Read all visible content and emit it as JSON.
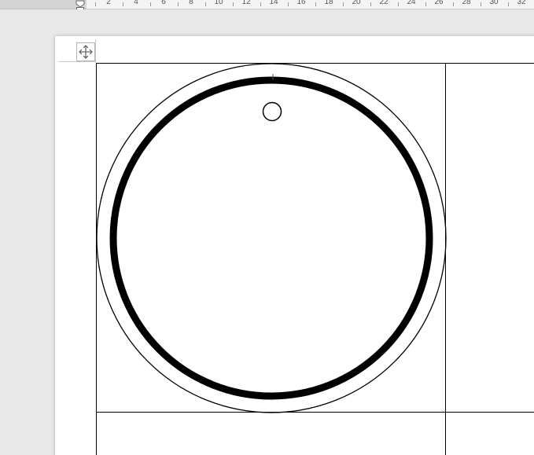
{
  "ruler": {
    "labels": [
      "2",
      "4",
      "6",
      "8",
      "10",
      "12",
      "14",
      "16",
      "18",
      "20",
      "22",
      "24",
      "26",
      "28",
      "30",
      "32"
    ]
  },
  "document": {
    "table": {
      "move_handle_icon": "four-way-arrow-icon",
      "label_template": {
        "shape": "circle-label-with-hang-hole",
        "outer_ring_stroke": "thin",
        "inner_ring_stroke": "thick",
        "hang_hole": true
      }
    }
  },
  "colors": {
    "app_background": "#e8e8e8",
    "page": "#ffffff",
    "ink": "#000000",
    "ruler_text": "#555555"
  }
}
